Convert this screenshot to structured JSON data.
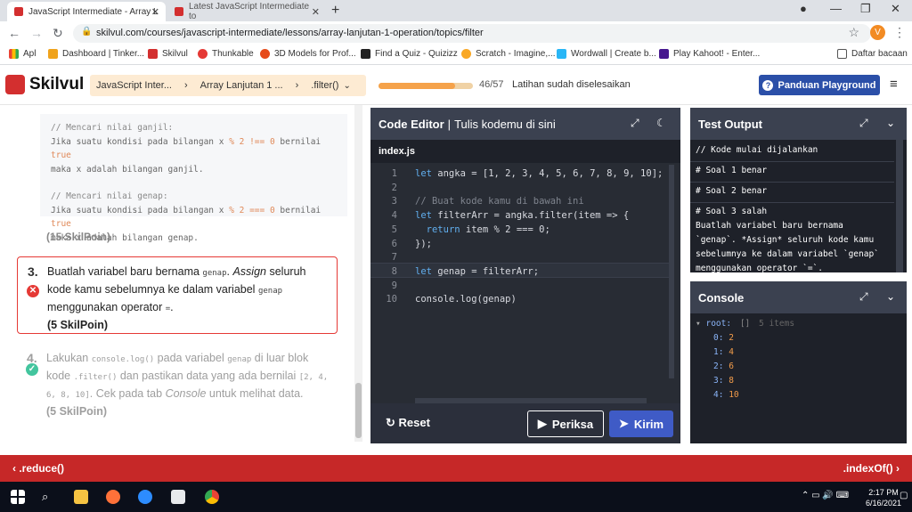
{
  "browser": {
    "tabs": [
      {
        "title": "JavaScript Intermediate - Array L",
        "active": true
      },
      {
        "title": "Latest JavaScript Intermediate to",
        "active": false
      }
    ],
    "url": "skilvul.com/courses/javascript-intermediate/lessons/array-lanjutan-1-operation/topics/filter",
    "profile_initial": "V",
    "bookmarks": [
      {
        "label": "Apl",
        "icon": "apps-grid-icon"
      },
      {
        "label": "Dashboard | Tinker...",
        "icon": "tinkercad-icon"
      },
      {
        "label": "Skilvul",
        "icon": "skilvul-icon"
      },
      {
        "label": "Thunkable",
        "icon": "thunkable-icon"
      },
      {
        "label": "3D Models for Prof...",
        "icon": "turbosquid-icon"
      },
      {
        "label": "Find a Quiz - Quizizz",
        "icon": "quizizz-icon"
      },
      {
        "label": "Scratch - Imagine,...",
        "icon": "scratch-icon"
      },
      {
        "label": "Wordwall | Create b...",
        "icon": "wordwall-icon"
      },
      {
        "label": "Play Kahoot! - Enter...",
        "icon": "kahoot-icon"
      },
      {
        "label": "Daftar bacaan",
        "icon": "reading-list-icon"
      }
    ]
  },
  "header": {
    "logo": "Skilvul",
    "breadcrumbs": [
      "JavaScript Inter...",
      "Array Lanjutan 1 ...",
      ".filter()"
    ],
    "progress_count": "46/57",
    "progress_fraction": 0.807,
    "progress_text": "Latihan sudah diselesaikan",
    "guide_button": "Panduan Playground"
  },
  "left": {
    "code_comment_odd": "// Mencari nilai ganjil:",
    "code_odd_1a": "Jika suatu kondisi pada bilangan x ",
    "code_odd_1b": "% 2 !== 0",
    "code_odd_1c": " bernilai ",
    "code_odd_1d": "true",
    "code_odd_2": "maka x adalah bilangan ganjil.",
    "code_comment_even": "// Mencari nilai genap:",
    "code_even_1a": "Jika suatu kondisi pada bilangan x ",
    "code_even_1b": "% 2 === 0",
    "code_even_1c": " bernilai ",
    "code_even_1d": "true",
    "code_even_2": "maka x adalah bilangan genap.",
    "points_prev": "(15 SkilPoin)",
    "task3": {
      "number": "3.",
      "t1": "Buatlah variabel baru bernama ",
      "c1": "genap",
      "t2": ". ",
      "em": "Assign",
      "t3": " seluruh kode kamu sebelumnya ke dalam variabel ",
      "c2": "genap",
      "t4": " menggunakan operator ",
      "c3": "=",
      "t5": ".",
      "points": "(5 SkilPoin)"
    },
    "task4": {
      "number": "4.",
      "t1": "Lakukan ",
      "c1": "console.log()",
      "t2": " pada variabel ",
      "c2": "genap",
      "t3": " di luar blok kode ",
      "c3": ".filter()",
      "t4": " dan pastikan data yang ada bernilai ",
      "c4": "[2, 4, 6, 8, 10]",
      "t5": ". Cek pada tab ",
      "em": "Console",
      "t6": " untuk melihat data.",
      "points": "(5 SkilPoin)"
    }
  },
  "editor": {
    "title": "Code Editor",
    "subtitle": "Tulis kodemu di sini",
    "filename": "index.js",
    "lines": [
      "let angka = [1, 2, 3, 4, 5, 6, 7, 8, 9, 10];",
      "",
      "// Buat kode kamu di bawah ini",
      "let filterArr = angka.filter(item => {",
      "  return item % 2 === 0;",
      "});",
      "",
      "let genap = filterArr;",
      "",
      "console.log(genap)"
    ],
    "reset_label": "Reset",
    "check_label": "Periksa",
    "send_label": "Kirim"
  },
  "test_output": {
    "title": "Test Output",
    "lines": [
      "// Kode mulai dijalankan",
      "# Soal 1 benar",
      "# Soal 2 benar",
      "# Soal 3 salah"
    ],
    "detail": [
      "Buatlah variabel baru bernama",
      "`genap`. *Assign* seluruh kode kamu",
      "sebelumnya ke dalam variabel `genap`",
      "menggunakan operator `=`."
    ]
  },
  "console": {
    "title": "Console",
    "root_label": "root:",
    "root_brackets": "[]",
    "root_count": "5 items",
    "items": [
      {
        "index": "0:",
        "value": "2"
      },
      {
        "index": "1:",
        "value": "4"
      },
      {
        "index": "2:",
        "value": "6"
      },
      {
        "index": "3:",
        "value": "8"
      },
      {
        "index": "4:",
        "value": "10"
      }
    ]
  },
  "footer": {
    "prev": ".reduce()",
    "next": ".indexOf()"
  },
  "taskbar": {
    "time": "2:17 PM",
    "date": "6/16/2021"
  },
  "colors": {
    "brand_red": "#c62828",
    "editor_bg": "#282c34",
    "accent_blue": "#2b4fa8",
    "progress_orange": "#f5a24a"
  }
}
